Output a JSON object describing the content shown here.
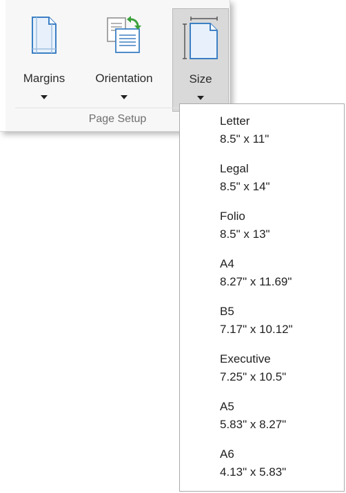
{
  "ribbon": {
    "group_label": "Page Setup",
    "buttons": [
      {
        "label": "Margins",
        "icon": "margins-icon"
      },
      {
        "label": "Orientation",
        "icon": "orientation-icon"
      },
      {
        "label": "Size",
        "icon": "paper-size-icon",
        "active": true
      }
    ]
  },
  "size_menu": {
    "items": [
      {
        "name": "Letter",
        "dims": "8.5\" x 11\""
      },
      {
        "name": "Legal",
        "dims": "8.5\" x 14\""
      },
      {
        "name": "Folio",
        "dims": "8.5\" x 13\""
      },
      {
        "name": "A4",
        "dims": "8.27\" x 11.69\""
      },
      {
        "name": "B5",
        "dims": "7.17\" x 10.12\""
      },
      {
        "name": "Executive",
        "dims": "7.25\" x 10.5\""
      },
      {
        "name": "A5",
        "dims": "5.83\" x 8.27\""
      },
      {
        "name": "A6",
        "dims": "4.13\" x 5.83\""
      }
    ]
  },
  "colors": {
    "icon_blue": "#3b7fc4",
    "icon_fill": "#e8f1fb",
    "arrow_green": "#3aa03a",
    "active_bg": "#d9d9d9"
  }
}
